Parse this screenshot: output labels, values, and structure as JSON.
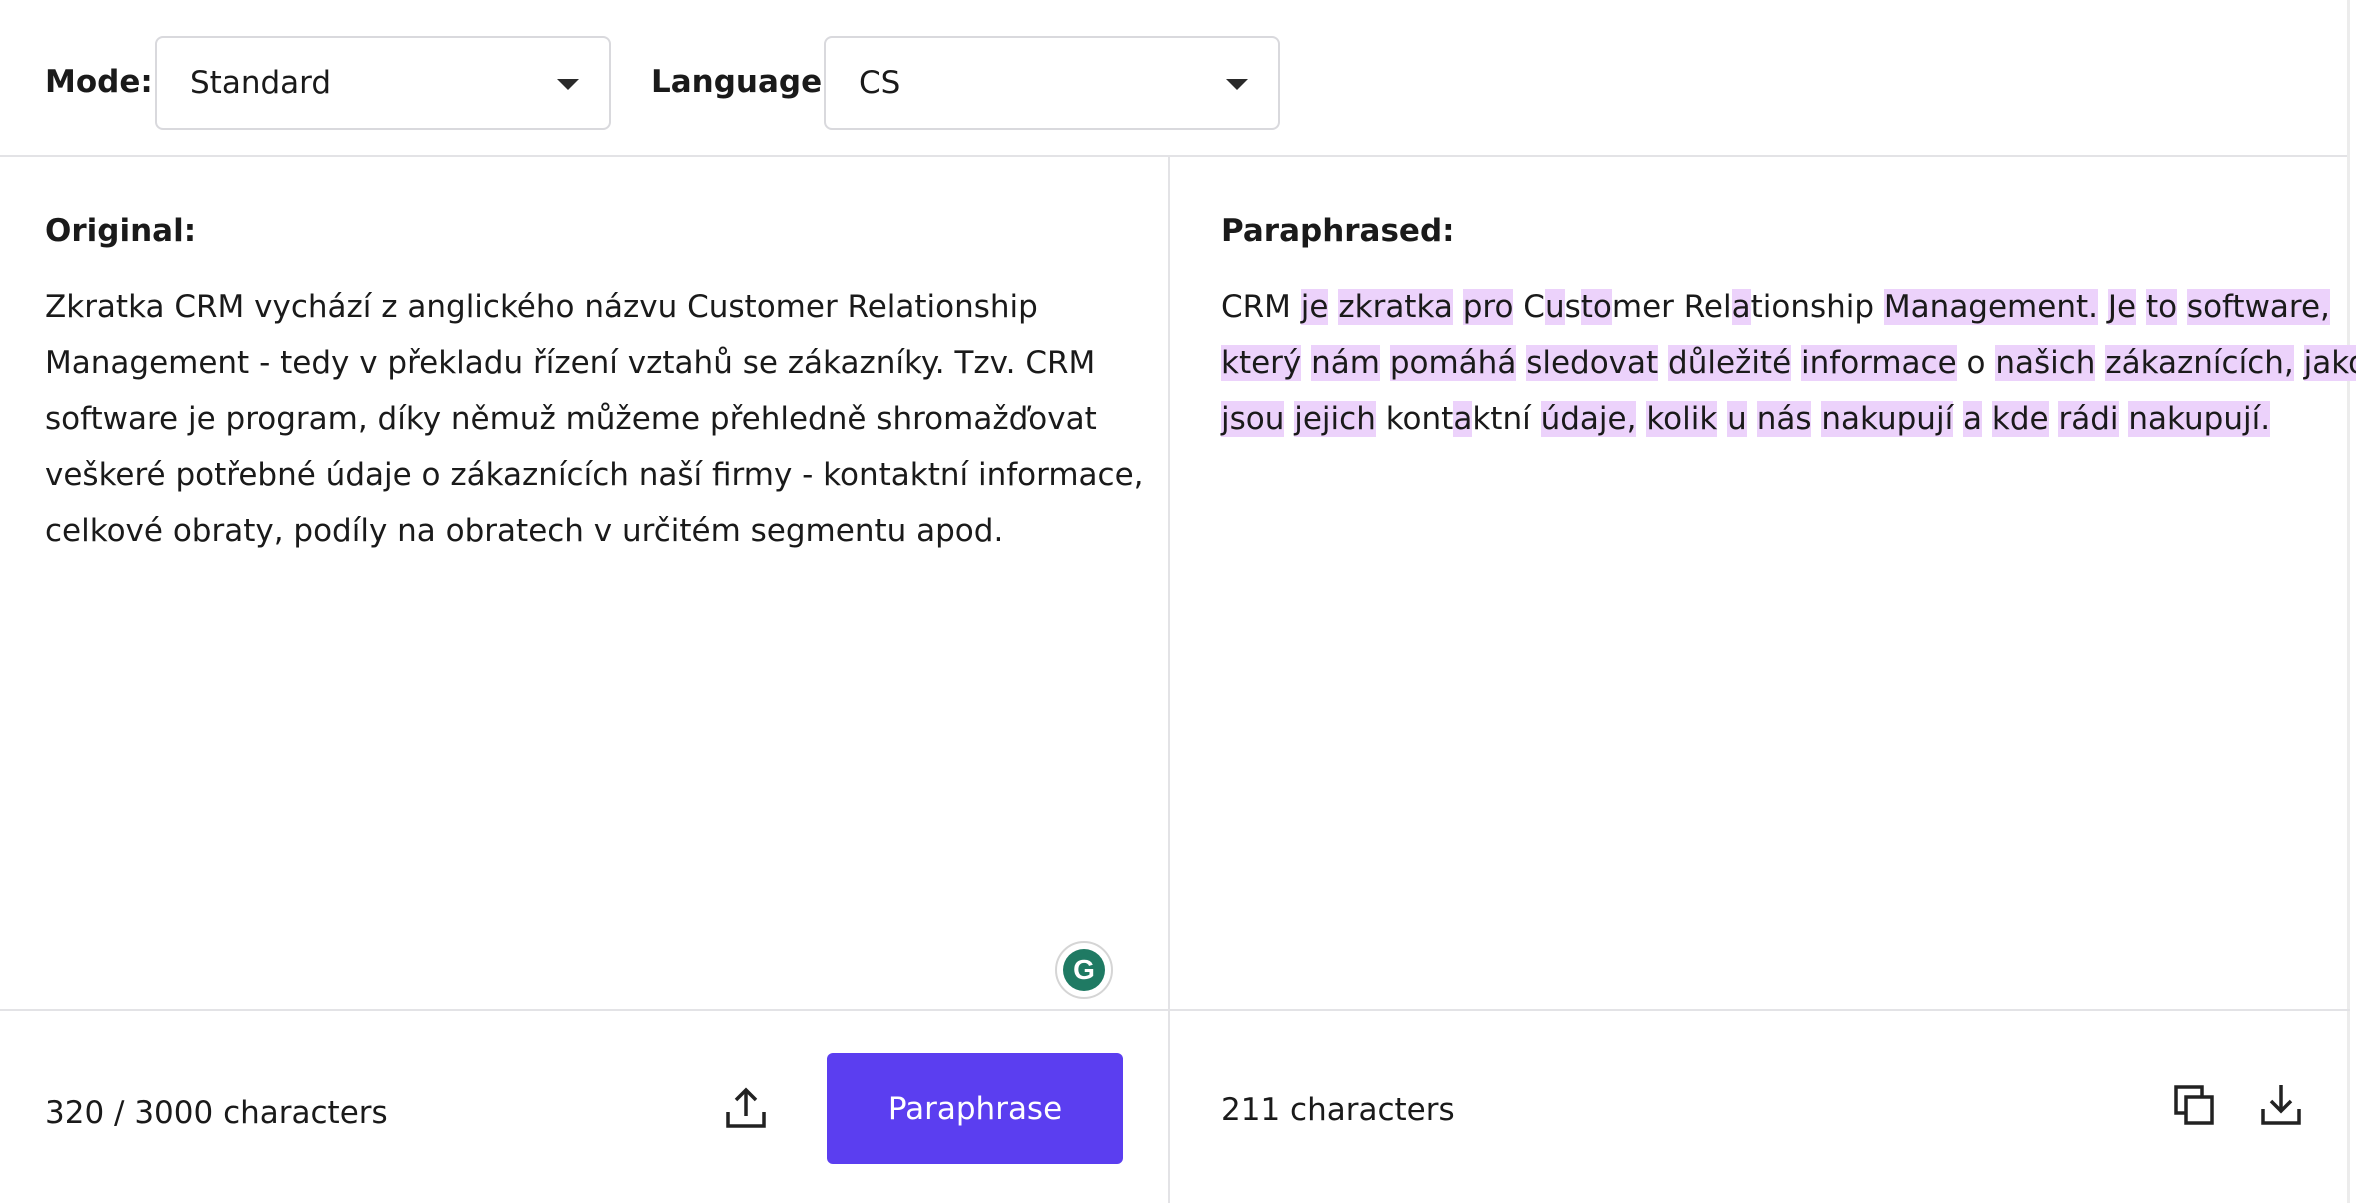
{
  "toolbar": {
    "mode_label": "Mode:",
    "mode_value": "Standard",
    "language_label": "Language:",
    "language_value": "CS"
  },
  "original": {
    "heading": "Original:",
    "lines": [
      "Zkratka CRM vychází z anglického názvu Customer Relationship",
      "Management - tedy v překladu řízení vztahů se zákazníky. Tzv. CRM",
      "software je program, díky němuž můžeme přehledně shromažďovat",
      "veškeré potřebné údaje o zákaznících naší firmy - kontaktní informace,",
      "celkové obraty, podíly na obratech v určitém segmentu apod."
    ],
    "char_count": "320 / 3000 characters",
    "paraphrase_button": "Paraphrase"
  },
  "paraphrased": {
    "heading": "Paraphrased:",
    "lines": [
      [
        {
          "t": "CRM ",
          "h": false
        },
        {
          "t": "je",
          "h": true
        },
        {
          "t": " ",
          "h": false
        },
        {
          "t": "zkratka",
          "h": true
        },
        {
          "t": " ",
          "h": false
        },
        {
          "t": "pro",
          "h": true
        },
        {
          "t": " C",
          "h": false
        },
        {
          "t": "u",
          "h": true
        },
        {
          "t": "s",
          "h": false
        },
        {
          "t": "to",
          "h": true
        },
        {
          "t": "mer Rel",
          "h": false
        },
        {
          "t": "a",
          "h": true
        },
        {
          "t": "tionship ",
          "h": false
        },
        {
          "t": "Management.",
          "h": true
        },
        {
          "t": " ",
          "h": false
        },
        {
          "t": "Je",
          "h": true
        },
        {
          "t": " ",
          "h": false
        },
        {
          "t": "to",
          "h": true
        },
        {
          "t": " ",
          "h": false
        },
        {
          "t": "software,",
          "h": true
        }
      ],
      [
        {
          "t": "který",
          "h": true
        },
        {
          "t": " ",
          "h": false
        },
        {
          "t": "nám",
          "h": true
        },
        {
          "t": " ",
          "h": false
        },
        {
          "t": "pomáhá",
          "h": true
        },
        {
          "t": " ",
          "h": false
        },
        {
          "t": "sledovat",
          "h": true
        },
        {
          "t": " ",
          "h": false
        },
        {
          "t": "důležité",
          "h": true
        },
        {
          "t": " ",
          "h": false
        },
        {
          "t": "informace",
          "h": true
        },
        {
          "t": " o ",
          "h": false
        },
        {
          "t": "našich",
          "h": true
        },
        {
          "t": " ",
          "h": false
        },
        {
          "t": "zákaznících,",
          "h": true
        },
        {
          "t": " ",
          "h": false
        },
        {
          "t": "jako",
          "h": true
        }
      ],
      [
        {
          "t": "jsou",
          "h": true
        },
        {
          "t": " ",
          "h": false
        },
        {
          "t": "jejich",
          "h": true
        },
        {
          "t": " kont",
          "h": false
        },
        {
          "t": "a",
          "h": true
        },
        {
          "t": "ktní ",
          "h": false
        },
        {
          "t": "údaje,",
          "h": true
        },
        {
          "t": " ",
          "h": false
        },
        {
          "t": "kolik",
          "h": true
        },
        {
          "t": " ",
          "h": false
        },
        {
          "t": "u",
          "h": true
        },
        {
          "t": " ",
          "h": false
        },
        {
          "t": "nás",
          "h": true
        },
        {
          "t": " ",
          "h": false
        },
        {
          "t": "nakupují",
          "h": true
        },
        {
          "t": " ",
          "h": false
        },
        {
          "t": "a",
          "h": true
        },
        {
          "t": " ",
          "h": false
        },
        {
          "t": "kde",
          "h": true
        },
        {
          "t": " ",
          "h": false
        },
        {
          "t": "rádi",
          "h": true
        },
        {
          "t": " ",
          "h": false
        },
        {
          "t": "nakupují.",
          "h": true
        }
      ]
    ],
    "char_count": "211 characters"
  },
  "colors": {
    "accent": "#5b3ef0",
    "highlight": "#ecd2fb",
    "grammarly": "#1f7a63"
  },
  "icons": {
    "upload": "upload-icon",
    "copy": "copy-icon",
    "download": "download-icon",
    "grammarly": "grammarly-icon",
    "caret": "chevron-down-icon"
  }
}
